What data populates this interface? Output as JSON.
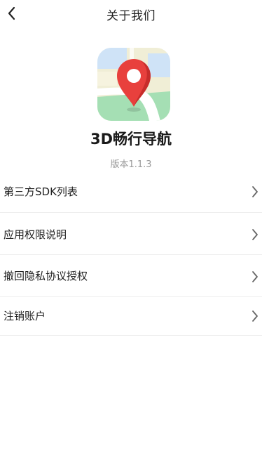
{
  "header": {
    "title": "关于我们",
    "back_icon": "chevron-left-icon"
  },
  "app": {
    "icon": "map-pin-app-icon",
    "name": "3D畅行导航",
    "version": "版本1.1.3"
  },
  "menu": {
    "items": [
      {
        "label": "第三方SDK列表",
        "icon": "chevron-right-icon"
      },
      {
        "label": "应用权限说明",
        "icon": "chevron-right-icon"
      },
      {
        "label": "撤回隐私协议授权",
        "icon": "chevron-right-icon"
      },
      {
        "label": "注销账户",
        "icon": "chevron-right-icon"
      }
    ]
  },
  "colors": {
    "background": "#ffffff",
    "text": "#222222",
    "muted": "#9a9a9a",
    "divider": "#eeeeee",
    "pin_red": "#e8403d",
    "map_green": "#a5dfb4",
    "map_beige": "#f0eed6",
    "map_blue": "#cfe3f7"
  }
}
